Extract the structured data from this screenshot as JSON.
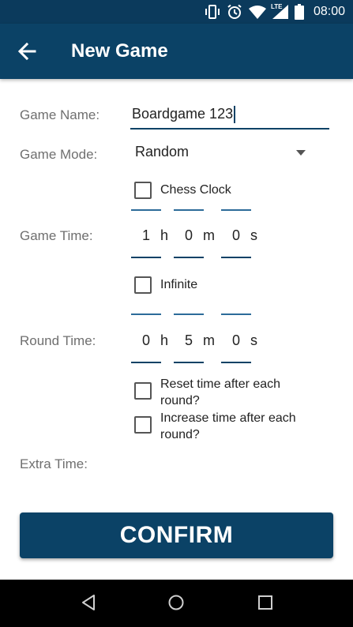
{
  "status_bar": {
    "time": "08:00",
    "network": "LTE",
    "icons": [
      "vibrate-icon",
      "alarm-icon",
      "wifi-icon",
      "signal-icon",
      "battery-icon"
    ]
  },
  "app_bar": {
    "title": "New Game",
    "back_icon": "arrow-left-icon"
  },
  "form": {
    "game_name": {
      "label": "Game Name:",
      "value": "Boardgame 123"
    },
    "game_mode": {
      "label": "Game Mode:",
      "selected": "Random"
    },
    "chess_clock": {
      "label": "Chess Clock",
      "checked": false
    },
    "game_time": {
      "label": "Game Time:",
      "hours": "1",
      "hours_unit": "h",
      "minutes": "0",
      "minutes_unit": "m",
      "seconds": "0",
      "seconds_unit": "s"
    },
    "infinite": {
      "label": "Infinite",
      "checked": false
    },
    "round_time": {
      "label": "Round Time:",
      "hours": "0",
      "hours_unit": "h",
      "minutes": "5",
      "minutes_unit": "m",
      "seconds": "0",
      "seconds_unit": "s"
    },
    "reset_time": {
      "label_line1": "Reset time after each",
      "label_line2": "round?",
      "checked": false
    },
    "increase_time": {
      "label_line1": "Increase time after each",
      "label_line2": "round?",
      "checked": false
    },
    "extra_time": {
      "label": "Extra Time:"
    }
  },
  "confirm_button": {
    "label": "CONFIRM"
  },
  "nav_bar": {
    "icons": [
      "back-triangle-icon",
      "home-circle-icon",
      "recents-square-icon"
    ]
  },
  "colors": {
    "primary": "#0b4266",
    "status_bar": "#0b3a5c",
    "label": "#6f6f6f"
  }
}
